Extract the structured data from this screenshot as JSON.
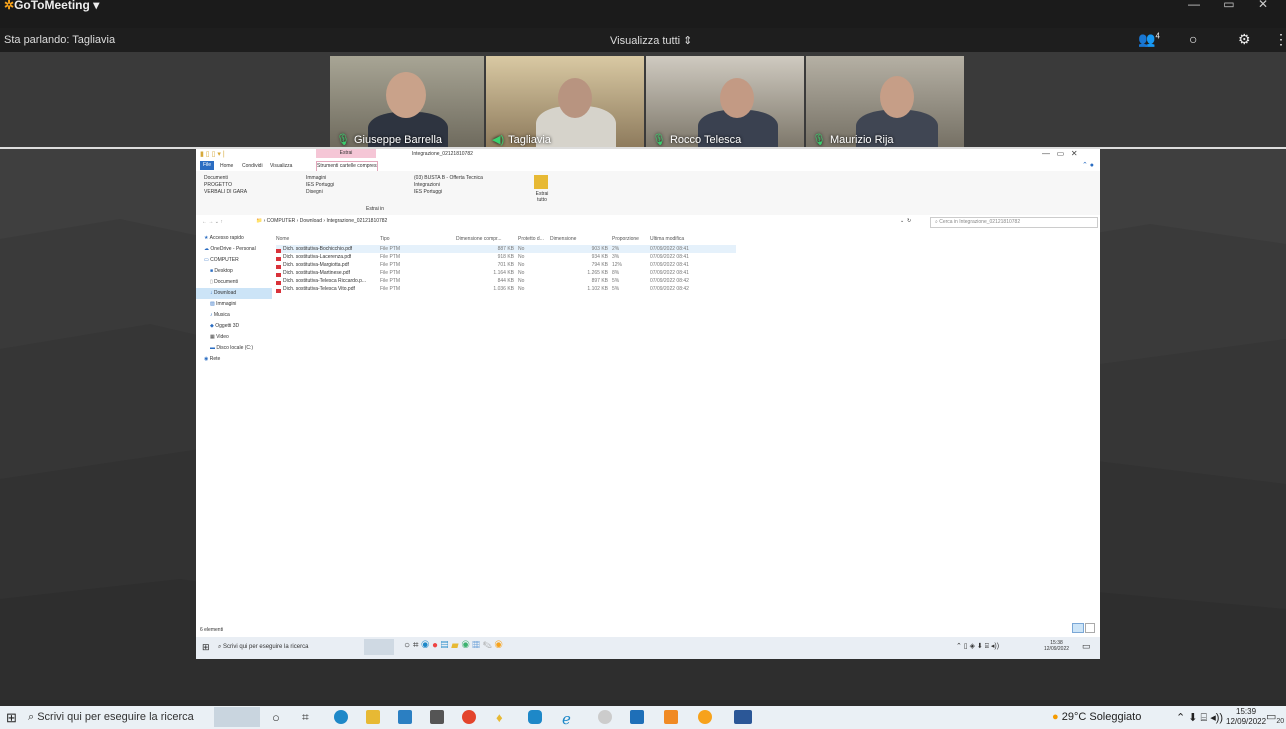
{
  "app": {
    "title": "GoToMeeting",
    "title_suffix": "▾"
  },
  "header": {
    "speaking": "Sta parlando: Tagliavia",
    "view_all": "Visualizza tutti",
    "view_all_icon": "updown-chevron-icon",
    "participant_count": "4"
  },
  "participants": [
    {
      "name": "Giuseppe Barrella",
      "mic": "on"
    },
    {
      "name": "Tagliavia",
      "mic": "speaking"
    },
    {
      "name": "Rocco Telesca",
      "mic": "on"
    },
    {
      "name": "Maurizio Rija",
      "mic": "on"
    }
  ],
  "explorer": {
    "window_title": "Integrazione_02121810782",
    "context_tab": "Estrai",
    "tabs": [
      "File",
      "Home",
      "Condividi",
      "Visualizza",
      "Strumenti cartelle compresse"
    ],
    "ribbon_cols": [
      [
        "Documenti",
        "PROGETTO",
        "VERBALI DI GARA"
      ],
      [
        "Immagini",
        "IES Portuggi",
        "Disegni"
      ],
      [
        "(03) BUSTA B - Offerta Tecnica",
        "Integrazioni",
        "IES Portuggi"
      ]
    ],
    "ribbon_extract_all": "Estrai tutto",
    "ribbon_group_label": "Estrai in",
    "breadcrumb": [
      "COMPUTER",
      "Download",
      "Integrazione_02121810782"
    ],
    "search_placeholder": "Cerca in Integrazione_02121810782",
    "nav_items": [
      "Accesso rapido",
      "OneDrive - Personal",
      "COMPUTER",
      "Desktop",
      "Documenti",
      "Download",
      "Immagini",
      "Musica",
      "Oggetti 3D",
      "Video",
      "Disco locale (C:)",
      "Rete"
    ],
    "columns": [
      "Nome",
      "Tipo",
      "Dimensione compr...",
      "Protetto d...",
      "Dimensione",
      "Proporzione",
      "Ultima modifica"
    ],
    "files": [
      {
        "name": "Dich. sostitutiva-Bochicchio.pdf",
        "type": "File PTM",
        "csize": "887 KB",
        "prot": "No",
        "size": "903 KB",
        "ratio": "2%",
        "date": "07/09/2022 08:41"
      },
      {
        "name": "Dich. sostitutiva-Lacerenza.pdf",
        "type": "File PTM",
        "csize": "918 KB",
        "prot": "No",
        "size": "934 KB",
        "ratio": "3%",
        "date": "07/09/2022 08:41"
      },
      {
        "name": "Dich. sostitutiva-Margiotta.pdf",
        "type": "File PTM",
        "csize": "701 KB",
        "prot": "No",
        "size": "794 KB",
        "ratio": "12%",
        "date": "07/09/2022 08:41"
      },
      {
        "name": "Dich. sostitutiva-Martinese.pdf",
        "type": "File PTM",
        "csize": "1.164 KB",
        "prot": "No",
        "size": "1.265 KB",
        "ratio": "8%",
        "date": "07/09/2022 08:41"
      },
      {
        "name": "Dich. sostitutiva-Telesca Riccardo.p...",
        "type": "File PTM",
        "csize": "844 KB",
        "prot": "No",
        "size": "897 KB",
        "ratio": "5%",
        "date": "07/09/2022 08:42"
      },
      {
        "name": "Dich. sostitutiva-Telesca Vito.pdf",
        "type": "File PTM",
        "csize": "1.036 KB",
        "prot": "No",
        "size": "1.102 KB",
        "ratio": "5%",
        "date": "07/09/2022 08:42"
      }
    ],
    "status": "6 elementi"
  },
  "inner_taskbar": {
    "search": "Scrivi qui per eseguire la ricerca",
    "time": "15:38",
    "date": "12/09/2022"
  },
  "taskbar": {
    "search": "Scrivi qui per eseguire la ricerca",
    "weather": "29°C Soleggiato",
    "time": "15:39",
    "date": "12/09/2022",
    "notif_count": "20"
  },
  "colors": {
    "accent_green": "#3bd16f",
    "pdf_red": "#d9323a",
    "context_tab_pink": "#f5c6d6"
  }
}
